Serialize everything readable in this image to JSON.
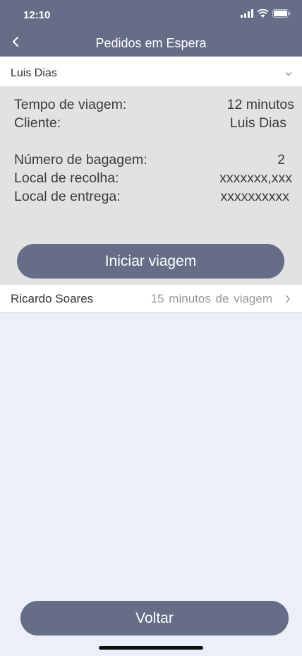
{
  "status_bar": {
    "time": "12:10",
    "icons": [
      "signal-icon",
      "wifi-icon",
      "battery-icon"
    ]
  },
  "nav": {
    "back_icon": "chevron-left-icon",
    "title": "Pedidos em Espera"
  },
  "expanded_request": {
    "name": "Luis Dias",
    "toggle_icon": "chevron-down-icon",
    "details": {
      "travel_time_label": "Tempo de viagem:",
      "travel_time_value": "12 minutos",
      "client_label": "Cliente:",
      "client_value": "Luis Dias",
      "luggage_label": "Número de bagagem:",
      "luggage_value": "2",
      "pickup_label": "Local de recolha:",
      "pickup_value": "xxxxxxx,xxx",
      "dropoff_label": "Local de entrega:",
      "dropoff_value": "xxxxxxxxxx"
    },
    "start_button": "Iniciar viagem"
  },
  "requests": [
    {
      "name": "Ricardo Soares",
      "trip": "15  minutos de viagem",
      "icon": "chevron-right-icon"
    }
  ],
  "footer": {
    "back_button": "Voltar"
  },
  "colors": {
    "header": "#656d87",
    "button": "#656d87",
    "panel": "#e2e2e2",
    "background": "#eceff7"
  }
}
